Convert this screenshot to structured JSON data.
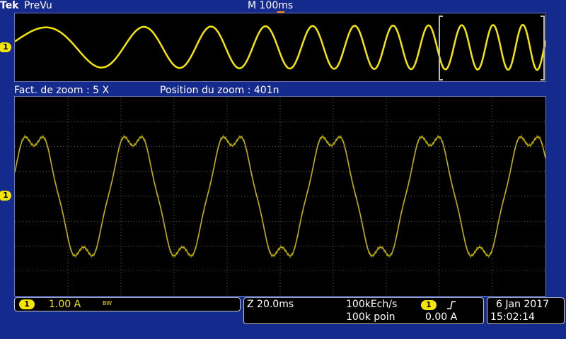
{
  "header": {
    "brand": "Tek",
    "app_title": "PreVu",
    "timebase": "M 100ms"
  },
  "zoom": {
    "factor_label": "Fact. de zoom : 5 X",
    "position_label": "Position du zoom  : 401n"
  },
  "channel": {
    "number": "1",
    "scale": "1.00 A",
    "bandwidth_icon": "BW",
    "color": "#f5e600"
  },
  "acquisition": {
    "zoom_timebase": "Z 20.0ms",
    "sample_rate": "100kEch/s",
    "record_length": "100k poin",
    "trigger_channel": "1",
    "trigger_slope_icon": "rising-edge-icon",
    "trigger_level": "0.00 A"
  },
  "clock": {
    "date": "6 Jan  2017",
    "time": "15:02:14"
  },
  "colors": {
    "background": "#142a8c",
    "trace": "#f5e600",
    "trigger_marker": "#ff8c00",
    "grid": "#808080"
  }
}
